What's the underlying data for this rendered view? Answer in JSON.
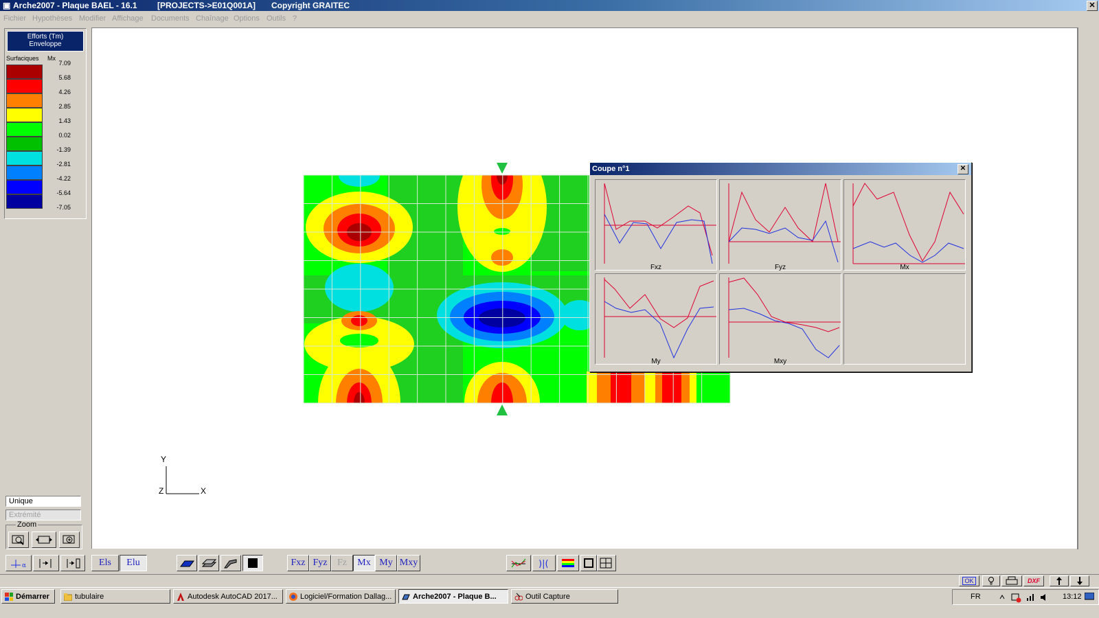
{
  "window": {
    "title": "Arche2007 - Plaque BAEL - 16.1",
    "project": "[PROJECTS->E01Q001A]",
    "copyright": "Copyright GRAITEC",
    "close_glyph": "✕"
  },
  "menu": [
    "Fichier",
    "Hypothèses",
    "Modifier",
    "Affichage",
    "Documents",
    "Chaînage",
    "Options",
    "Outils",
    "?"
  ],
  "legend": {
    "header_line1": "Efforts (Tm)",
    "header_line2": "Enveloppe",
    "type_label": "Surfaciques",
    "component_label": "Mx",
    "values": [
      "7.09",
      "5.68",
      "4.26",
      "2.85",
      "1.43",
      "0.02",
      "-1.39",
      "-2.81",
      "-4.22",
      "-5.64",
      "-7.05"
    ],
    "colors": [
      "#aa0000",
      "#ff0000",
      "#ff8000",
      "#ffff00",
      "#00ff00",
      "#00c000",
      "#00e0e0",
      "#0080ff",
      "#0000ff",
      "#0000a0"
    ]
  },
  "axes": {
    "y": "Y",
    "z": "Z",
    "x": "X"
  },
  "popup": {
    "title": "Coupe n°1",
    "close_glyph": "✕",
    "charts": [
      "Fxz",
      "Fyz",
      "Mx",
      "My",
      "Mxy"
    ]
  },
  "controls": {
    "mode_unique": "Unique",
    "mode_extremite": "Extrémité",
    "zoom_label": "Zoom"
  },
  "toolbar": {
    "els": "Els",
    "elu": "Elu",
    "fxz": "Fxz",
    "fyz": "Fyz",
    "fz": "Fz",
    "mx": "Mx",
    "my": "My",
    "mxy": "Mxy"
  },
  "status_icons": {
    "ok": "OK",
    "dxf": "DXF"
  },
  "taskbar": {
    "start": "Démarrer",
    "tasks": [
      "tubulaire",
      "Autodesk AutoCAD 2017...",
      "Logiciel/Formation Dallag...",
      "Arche2007 - Plaque B...",
      "Outil Capture"
    ],
    "lang": "FR",
    "time": "13:12"
  }
}
